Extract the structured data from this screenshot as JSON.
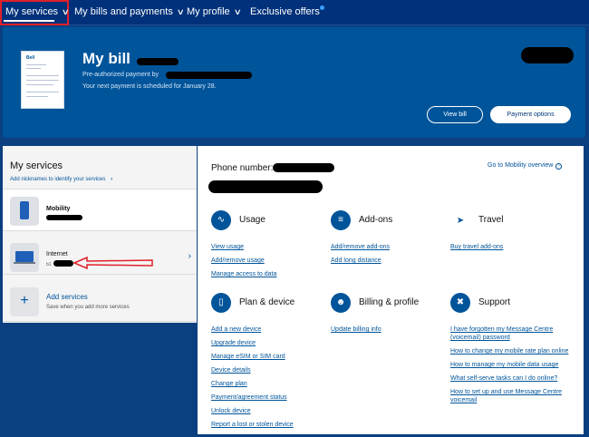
{
  "nav": {
    "items": [
      {
        "label": "My services"
      },
      {
        "label": "My bills and payments"
      },
      {
        "label": "My profile"
      },
      {
        "label": "Exclusive offers"
      }
    ]
  },
  "bill": {
    "doc_logo": "Bell",
    "title": "My bill",
    "preauth": "Pre-authorized payment by",
    "next_payment": "Your next payment is scheduled for January 28.",
    "view_bill": "View bill",
    "payment_options": "Payment options"
  },
  "left": {
    "title": "My services",
    "nickname_link": "Add nicknames to identify your services",
    "mobility": "Mobility",
    "internet": "Internet",
    "internet_prefix": "b1",
    "add_services": "Add services",
    "add_services_sub": "Save when you add more services"
  },
  "right": {
    "phone_label": "Phone number:",
    "mobility_overview": "Go to Mobility overview",
    "sections": {
      "usage": {
        "title": "Usage",
        "links": [
          "View usage",
          "Add/remove usage",
          "Manage access to data"
        ]
      },
      "addons": {
        "title": "Add-ons",
        "links": [
          "Add/remove add-ons",
          "Add long distance"
        ]
      },
      "travel": {
        "title": "Travel",
        "links": [
          "Buy travel add-ons"
        ]
      },
      "plan": {
        "title": "Plan & device",
        "links": [
          "Add a new device",
          "Upgrade device",
          "Manage eSIM or SIM card",
          "Device details",
          "Change plan",
          "Payment/agreement status",
          "Unlock device",
          "Report a lost or stolen device"
        ]
      },
      "billing": {
        "title": "Billing & profile",
        "links": [
          "Update billing info"
        ]
      },
      "support": {
        "title": "Support",
        "links": [
          "I have forgotten my Message Centre (voicemail) password",
          "How to change my mobile rate plan online",
          "How to manage my mobile data usage",
          "What self-serve tasks can I do online?",
          "How to set up and use Message Centre voicemail"
        ]
      }
    }
  },
  "colors": {
    "brand": "#00549a",
    "nav": "#00317a",
    "highlight": "#e0202a"
  }
}
